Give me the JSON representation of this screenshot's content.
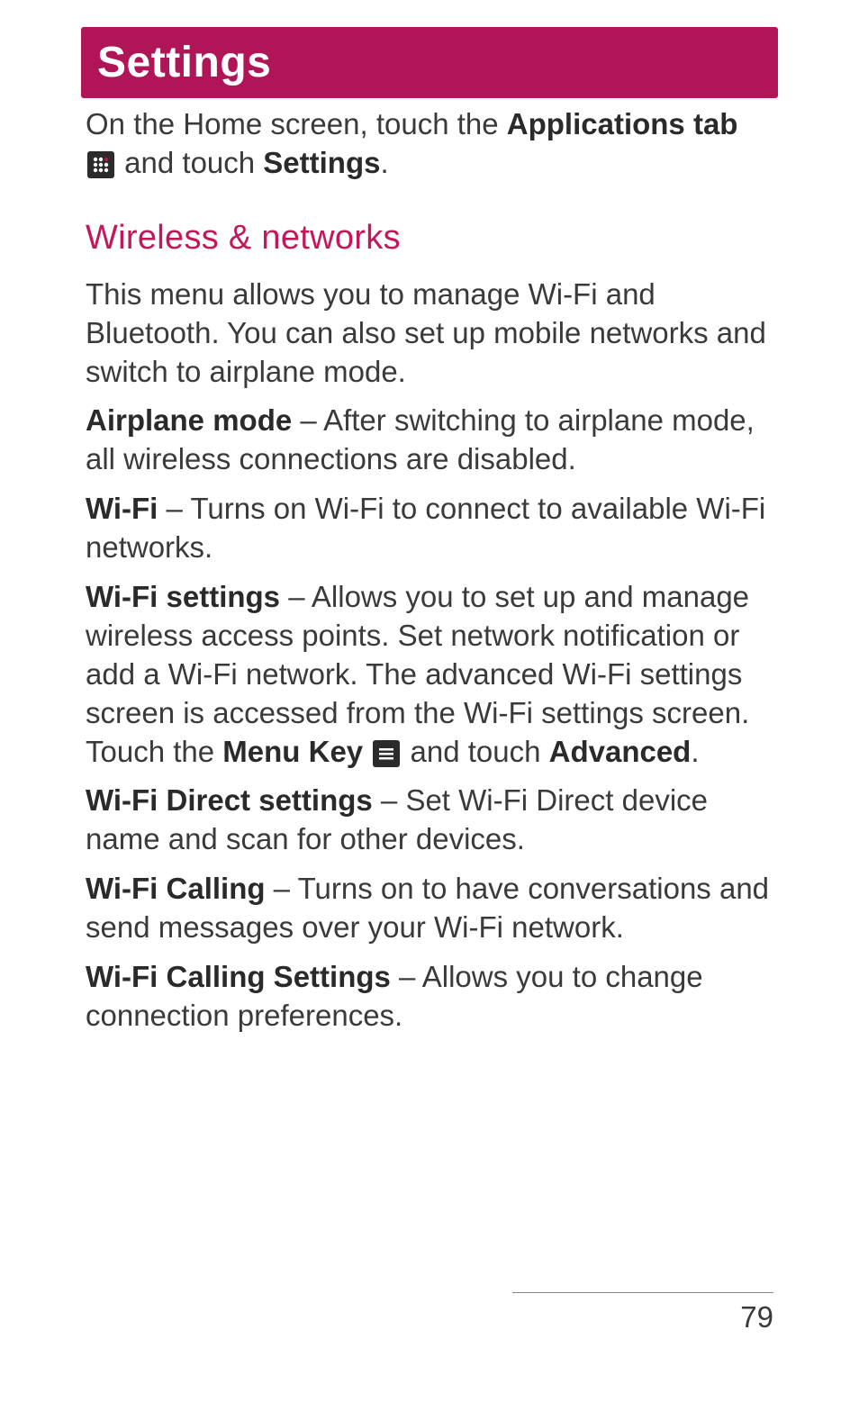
{
  "title": "Settings",
  "intro": {
    "text1": "On the Home screen, touch the ",
    "bold1": "Applications tab",
    "text2": " and touch ",
    "bold2": "Settings",
    "text3": "."
  },
  "section_heading": "Wireless & networks",
  "para1": "This menu allows you to manage Wi-Fi and Bluetooth. You can also set up mobile networks and switch to airplane mode.",
  "airplane": {
    "bold": "Airplane mode",
    "text": " – After switching to airplane mode, all wireless connections are disabled."
  },
  "wifi": {
    "bold": "Wi-Fi",
    "text": " – Turns on Wi-Fi to connect to available Wi-Fi networks."
  },
  "wifi_settings": {
    "bold": "Wi-Fi settings",
    "text1": " – Allows you to set up and manage wireless access points. Set network notification or add a Wi-Fi network. The advanced Wi-Fi settings screen is accessed from the Wi-Fi settings screen. Touch the ",
    "bold2": "Menu Key",
    "text2": " and touch ",
    "bold3": "Advanced",
    "text3": "."
  },
  "wifi_direct": {
    "bold": "Wi-Fi Direct settings",
    "text": " – Set Wi-Fi Direct device name and scan for other devices."
  },
  "wifi_calling": {
    "bold": "Wi-Fi Calling",
    "text": " – Turns on to  have conversations and send messages over your Wi-Fi network."
  },
  "wifi_calling_settings": {
    "bold": "Wi-Fi Calling Settings",
    "text": " – Allows you to change connection preferences."
  },
  "page_number": "79"
}
